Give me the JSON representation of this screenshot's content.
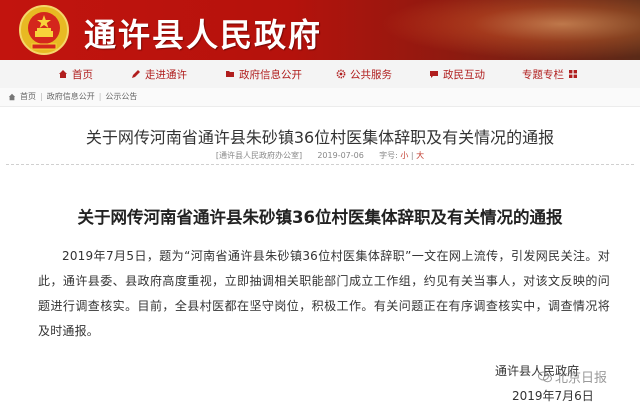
{
  "header": {
    "site_title": "通许县人民政府"
  },
  "nav": {
    "items": [
      {
        "label": "首页",
        "icon": "home-icon"
      },
      {
        "label": "走进通许",
        "icon": "pencil-icon"
      },
      {
        "label": "政府信息公开",
        "icon": "folder-icon"
      },
      {
        "label": "公共服务",
        "icon": "gear-icon"
      },
      {
        "label": "政民互动",
        "icon": "chat-icon"
      },
      {
        "label": "专题专栏",
        "icon": "grid-icon"
      }
    ]
  },
  "breadcrumb": {
    "items": [
      "首页",
      "政府信息公开",
      "公示公告"
    ]
  },
  "article": {
    "title": "关于网传河南省通许县朱砂镇36位村医集体辞职及有关情况的通报",
    "source": "[通许县人民政府办公室]",
    "date": "2019-07-06",
    "font_label": "字号:",
    "font_small": "小",
    "font_sep": "|",
    "font_large": "大",
    "body_title": "关于网传河南省通许县朱砂镇36位村医集体辞职及有关情况的通报",
    "paragraph": "2019年7月5日，题为“河南省通许县朱砂镇36位村医集体辞职”一文在网上流传，引发网民关注。对此，通许县委、县政府高度重视，立即抽调相关职能部门成立工作组，约见有关当事人，对该文反映的问题进行调查核实。目前，全县村医都在坚守岗位，积极工作。有关问题正在有序调查核实中，调查情况将及时通报。",
    "signature_org": "通许县人民政府",
    "signature_date": "2019年7月6日"
  },
  "watermark": {
    "text": "北京日报"
  },
  "colors": {
    "banner_red": "#c2140e",
    "nav_text": "#b01e1e",
    "link_red": "#c0392b"
  }
}
